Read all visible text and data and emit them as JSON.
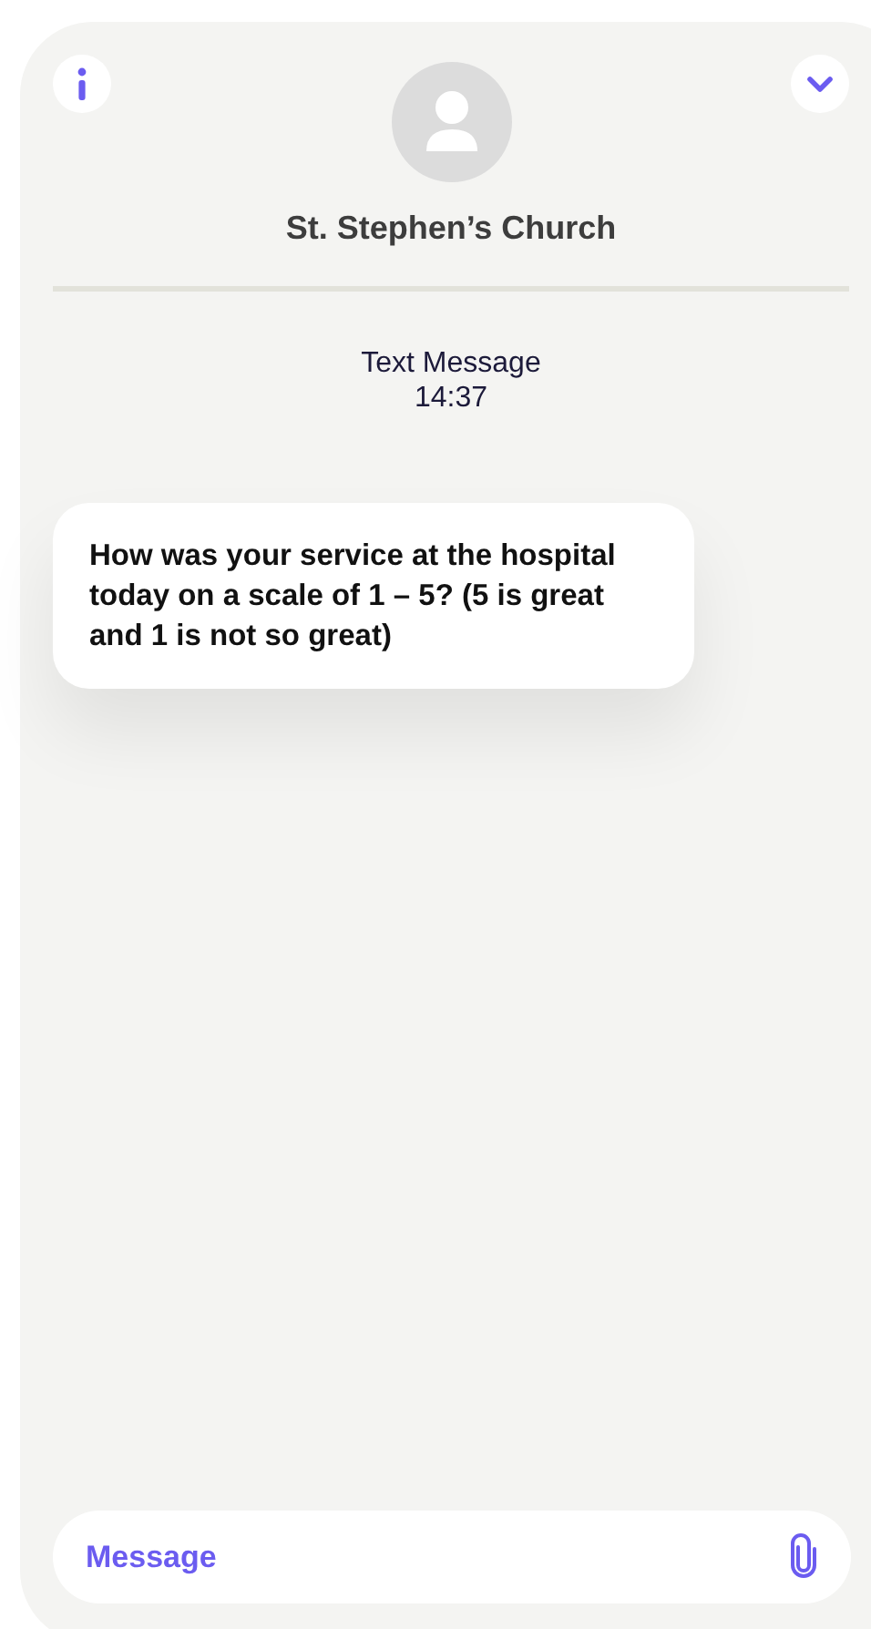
{
  "contact": {
    "name": "St. Stephen’s Church"
  },
  "thread_header": {
    "label": "Text Message",
    "time": "14:37"
  },
  "messages": [
    {
      "text": "How was your service at the hospital today on a scale of 1 – 5? (5 is great and 1 is not so great)"
    }
  ],
  "composer": {
    "placeholder": "Message"
  }
}
